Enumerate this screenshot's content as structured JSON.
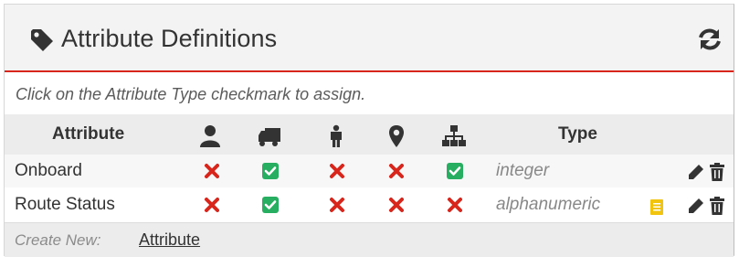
{
  "panel": {
    "title": "Attribute Definitions",
    "title_icon": "tag-icon",
    "refresh_icon": "refresh-icon",
    "accent_color": "#d9261c"
  },
  "hint": "Click on the Attribute Type checkmark to assign.",
  "table": {
    "headers": {
      "attribute": "Attribute",
      "type": "Type"
    },
    "type_columns": [
      "user-icon",
      "truck-icon",
      "person-icon",
      "map-marker-icon",
      "sitemap-icon"
    ],
    "rows": [
      {
        "name": "Onboard",
        "assignments": [
          false,
          true,
          false,
          false,
          true
        ],
        "type": "integer",
        "has_note": false
      },
      {
        "name": "Route Status",
        "assignments": [
          false,
          true,
          false,
          false,
          false
        ],
        "type": "alphanumeric",
        "has_note": true
      }
    ],
    "colors": {
      "unassigned": "#d9261c",
      "assigned": "#27ae60",
      "note": "#f1c40f"
    }
  },
  "footer": {
    "label": "Create New:",
    "link": "Attribute"
  }
}
